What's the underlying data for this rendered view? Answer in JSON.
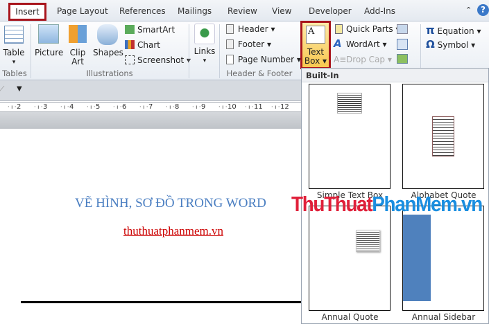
{
  "tabs": [
    "Insert",
    "Page Layout",
    "References",
    "Mailings",
    "Review",
    "View",
    "Developer",
    "Add-Ins"
  ],
  "ribbon": {
    "tables": {
      "table": "Table",
      "group": "Tables"
    },
    "illustrations": {
      "picture": "Picture",
      "clip1": "Clip",
      "clip2": "Art",
      "shapes": "Shapes",
      "smartart": "SmartArt",
      "chart": "Chart",
      "screenshot": "Screenshot",
      "group": "Illustrations"
    },
    "links": {
      "links": "Links"
    },
    "header_footer": {
      "header": "Header",
      "footer": "Footer",
      "page_number": "Page Number",
      "group": "Header & Footer"
    },
    "text": {
      "textbox1": "Text",
      "textbox2": "Box",
      "quick_parts": "Quick Parts",
      "wordart": "WordArt",
      "drop_cap": "Drop Cap"
    },
    "symbols": {
      "equation": "Equation",
      "symbol": "Symbol"
    }
  },
  "ruler": [
    "2",
    "3",
    "4",
    "5",
    "6",
    "7",
    "8",
    "9",
    "10",
    "11",
    "12"
  ],
  "document": {
    "title": "VẼ HÌNH, SƠ ĐỒ TRONG WORD",
    "link": "thuthuatphanmem.vn"
  },
  "dropdown": {
    "header": "Built-In",
    "items": [
      "Simple Text Box",
      "Alphabet Quote",
      "Annual Quote",
      "Annual Sidebar"
    ]
  },
  "watermark": {
    "part1": "ThuThuat",
    "part2": "PhanMem.vn"
  },
  "colors": {
    "accent": "#a8141c",
    "title": "#4a7ec1",
    "link": "#cc0000",
    "sidebar": "#4f81bd"
  }
}
